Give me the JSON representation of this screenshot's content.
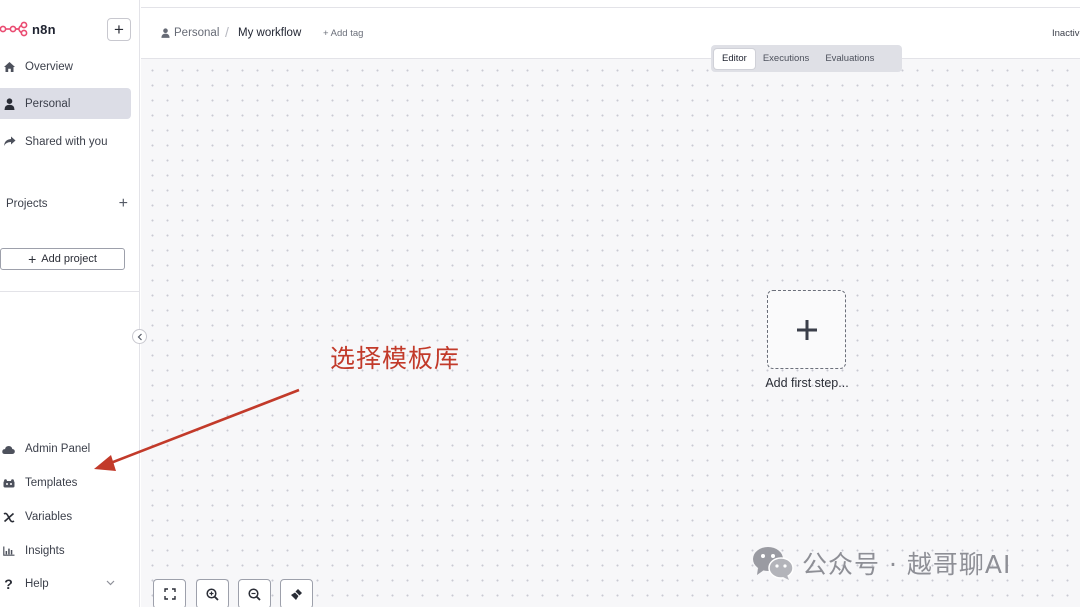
{
  "app": {
    "name": "n8n"
  },
  "sidebar": {
    "nav": [
      {
        "label": "Overview",
        "icon": "home-icon"
      },
      {
        "label": "Personal",
        "icon": "user-icon"
      },
      {
        "label": "Shared with you",
        "icon": "share-icon"
      }
    ],
    "projects_label": "Projects",
    "add_project_label": "Add project",
    "bottom": [
      {
        "label": "Admin Panel",
        "icon": "cloud-icon"
      },
      {
        "label": "Templates",
        "icon": "templates-icon"
      },
      {
        "label": "Variables",
        "icon": "variables-icon"
      },
      {
        "label": "Insights",
        "icon": "insights-icon"
      },
      {
        "label": "Help",
        "icon": "help-icon"
      }
    ]
  },
  "header": {
    "breadcrumb_project": "Personal",
    "breadcrumb_separator": "/",
    "workflow_name": "My workflow",
    "add_tag": "+ Add tag",
    "status": "Inactive"
  },
  "tabs": [
    {
      "label": "Editor",
      "active": true
    },
    {
      "label": "Executions",
      "active": false
    },
    {
      "label": "Evaluations",
      "active": false
    }
  ],
  "canvas": {
    "add_step_label": "Add first step..."
  },
  "annotation": {
    "text": "选择模板库",
    "color": "#c23a2a"
  },
  "watermark": {
    "text": "公众号 · 越哥聊AI"
  },
  "colors": {
    "brand": "#ea4b71",
    "active_nav_bg": "#dcdde6"
  }
}
